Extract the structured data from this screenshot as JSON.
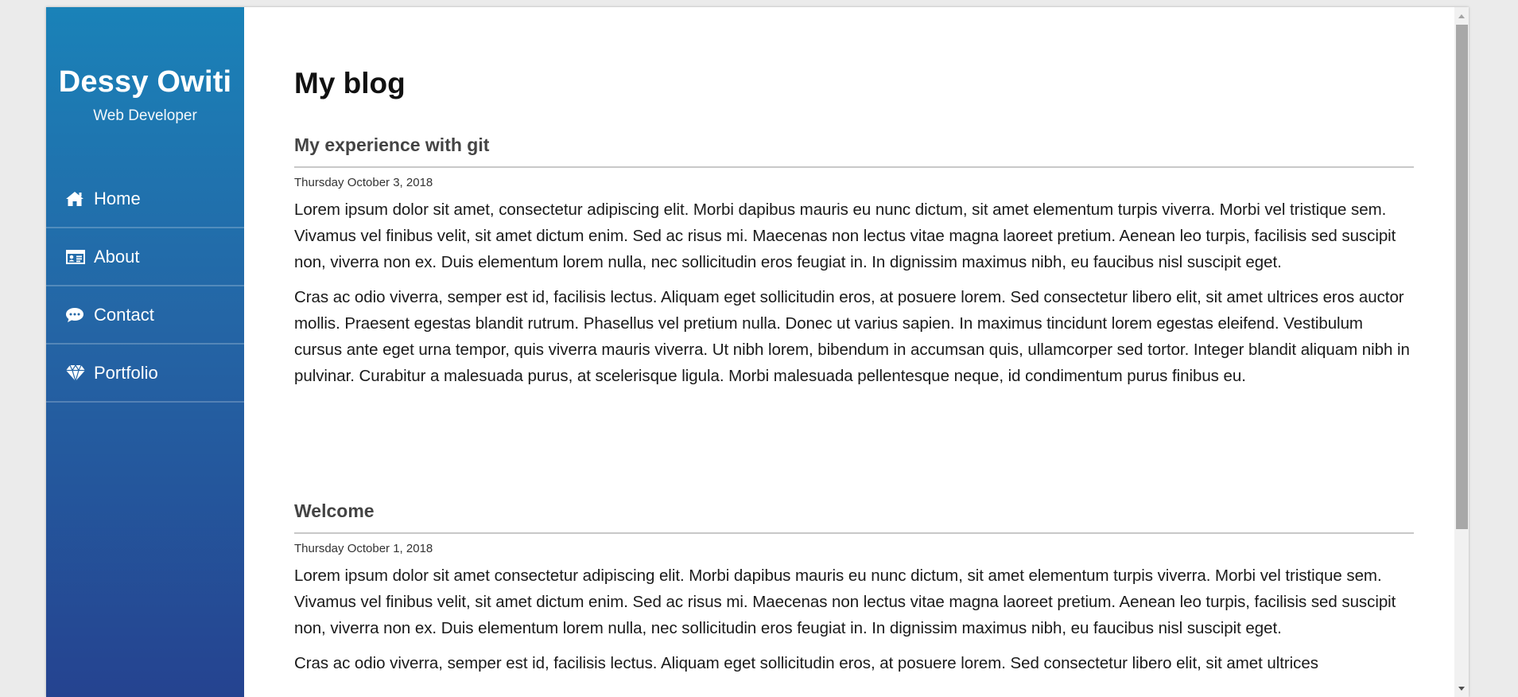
{
  "sidebar": {
    "name": "Dessy Owiti",
    "role": "Web Developer",
    "items": [
      {
        "label": "Home",
        "icon": "home-icon"
      },
      {
        "label": "About",
        "icon": "id-card-icon"
      },
      {
        "label": "Contact",
        "icon": "comment-icon"
      },
      {
        "label": "Portfolio",
        "icon": "diamond-icon"
      }
    ]
  },
  "main": {
    "title": "My blog",
    "posts": [
      {
        "title": "My experience with git",
        "date": "Thursday October 3, 2018",
        "paragraphs": [
          "Lorem ipsum dolor sit amet, consectetur adipiscing elit. Morbi dapibus mauris eu nunc dictum, sit amet elementum turpis viverra. Morbi vel tristique sem. Vivamus vel finibus velit, sit amet dictum enim. Sed ac risus mi. Maecenas non lectus vitae magna laoreet pretium. Aenean leo turpis, facilisis sed suscipit non, viverra non ex. Duis elementum lorem nulla, nec sollicitudin eros feugiat in. In dignissim maximus nibh, eu faucibus nisl suscipit eget.",
          "Cras ac odio viverra, semper est id, facilisis lectus. Aliquam eget sollicitudin eros, at posuere lorem. Sed consectetur libero elit, sit amet ultrices eros auctor mollis. Praesent egestas blandit rutrum. Phasellus vel pretium nulla. Donec ut varius sapien. In maximus tincidunt lorem egestas eleifend. Vestibulum cursus ante eget urna tempor, quis viverra mauris viverra. Ut nibh lorem, bibendum in accumsan quis, ullamcorper sed tortor. Integer blandit aliquam nibh in pulvinar. Curabitur a malesuada purus, at scelerisque ligula. Morbi malesuada pellentesque neque, id condimentum purus finibus eu."
        ]
      },
      {
        "title": "Welcome",
        "date": "Thursday October 1, 2018",
        "paragraphs": [
          "Lorem ipsum dolor sit amet consectetur adipiscing elit. Morbi dapibus mauris eu nunc dictum, sit amet elementum turpis viverra. Morbi vel tristique sem. Vivamus vel finibus velit, sit amet dictum enim. Sed ac risus mi. Maecenas non lectus vitae magna laoreet pretium. Aenean leo turpis, facilisis sed suscipit non, viverra non ex. Duis elementum lorem nulla, nec sollicitudin eros feugiat in. In dignissim maximus nibh, eu faucibus nisl suscipit eget.",
          "Cras ac odio viverra, semper est id, facilisis lectus. Aliquam eget sollicitudin eros, at posuere lorem. Sed consectetur libero elit, sit amet ultrices"
        ]
      }
    ]
  },
  "colors": {
    "sidebar_top": "#1a82b8",
    "sidebar_bottom": "#254390",
    "background": "#ebebeb"
  }
}
